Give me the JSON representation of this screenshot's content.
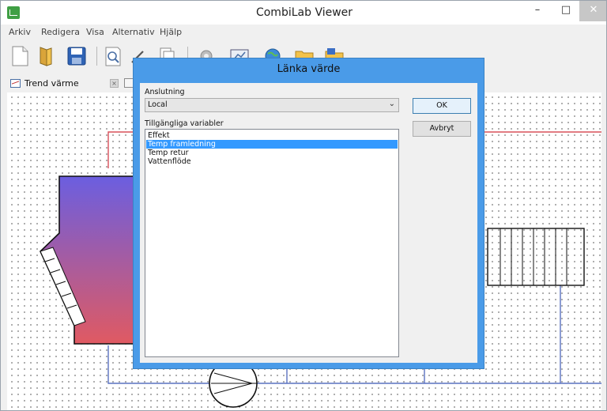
{
  "window": {
    "title": "CombiLab Viewer",
    "minimize_glyph": "–",
    "maximize_glyph": "□",
    "close_glyph": "✕"
  },
  "menu": {
    "items": [
      "Arkiv",
      "Redigera",
      "Visa",
      "Alternativ",
      "Hjälp"
    ]
  },
  "toolbar": {
    "icons": [
      "new-document-icon",
      "open-folder-icon",
      "save-icon",
      "print-preview-icon",
      "edit-icon",
      "copy-icon",
      "gear-icon",
      "display-icon",
      "globe-icon",
      "folder-icon",
      "folder-open-icon"
    ]
  },
  "tabs": [
    {
      "label": "Trend värme",
      "close_glyph": "×"
    }
  ],
  "dialog": {
    "title": "Länka värde",
    "connection_label": "Anslutning",
    "connection_value": "Local",
    "variables_label": "Tillgängliga variabler",
    "variables": [
      "Effekt",
      "Temp framledning",
      "Temp retur",
      "Vattenflöde"
    ],
    "selected_index": 1,
    "ok_label": "OK",
    "cancel_label": "Avbryt"
  },
  "colors": {
    "dialog_frame": "#4a9be8",
    "selection": "#3399ff",
    "pipe_supply": "#d9505a",
    "pipe_return": "#5a72c0",
    "tank_top": "#6b5ee0",
    "tank_bottom": "#e05a62"
  }
}
